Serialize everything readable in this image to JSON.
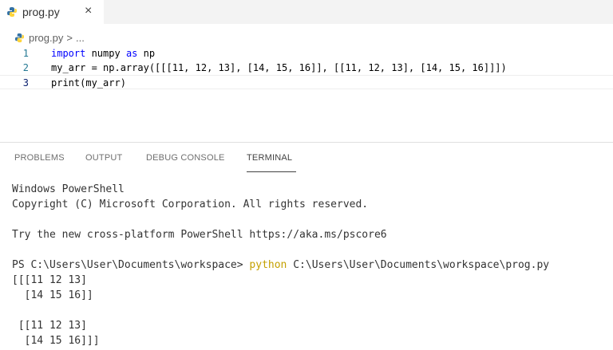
{
  "tab": {
    "filename": "prog.py",
    "close_glyph": "×"
  },
  "breadcrumb": {
    "file": "prog.py",
    "separator": ">",
    "ellipsis": "..."
  },
  "editor": {
    "lines": [
      {
        "number": "1",
        "parts": [
          {
            "t": "import",
            "kw": true
          },
          {
            "t": " numpy ",
            "kw": false
          },
          {
            "t": "as",
            "kw": true
          },
          {
            "t": " np",
            "kw": false
          }
        ]
      },
      {
        "number": "2",
        "parts": [
          {
            "t": "my_arr = np.array([[[11, 12, 13], [14, 15, 16]], [[11, 12, 13], [14, 15, 16]]])",
            "kw": false
          }
        ]
      },
      {
        "number": "3",
        "parts": [
          {
            "t": "print(my_arr)",
            "kw": false
          }
        ]
      }
    ],
    "active_line": 3
  },
  "panel": {
    "tabs": [
      "PROBLEMS",
      "OUTPUT",
      "DEBUG CONSOLE",
      "TERMINAL"
    ],
    "active_tab": "TERMINAL"
  },
  "terminal": {
    "lines": [
      {
        "text": "Windows PowerShell"
      },
      {
        "text": "Copyright (C) Microsoft Corporation. All rights reserved."
      },
      {
        "text": ""
      },
      {
        "text": "Try the new cross-platform PowerShell https://aka.ms/pscore6"
      },
      {
        "text": ""
      },
      {
        "prompt": "PS C:\\Users\\User\\Documents\\workspace> ",
        "command": "python",
        "args": " C:\\Users\\User\\Documents\\workspace\\prog.py"
      },
      {
        "text": "[[[11 12 13]"
      },
      {
        "text": "  [14 15 16]]"
      },
      {
        "text": ""
      },
      {
        "text": " [[11 12 13]"
      },
      {
        "text": "  [14 15 16]]]"
      }
    ]
  },
  "colors": {
    "keyword": "#0000ff",
    "line_number": "#237893",
    "command_highlight": "#c4a000",
    "python_icon": "#3572a5"
  }
}
